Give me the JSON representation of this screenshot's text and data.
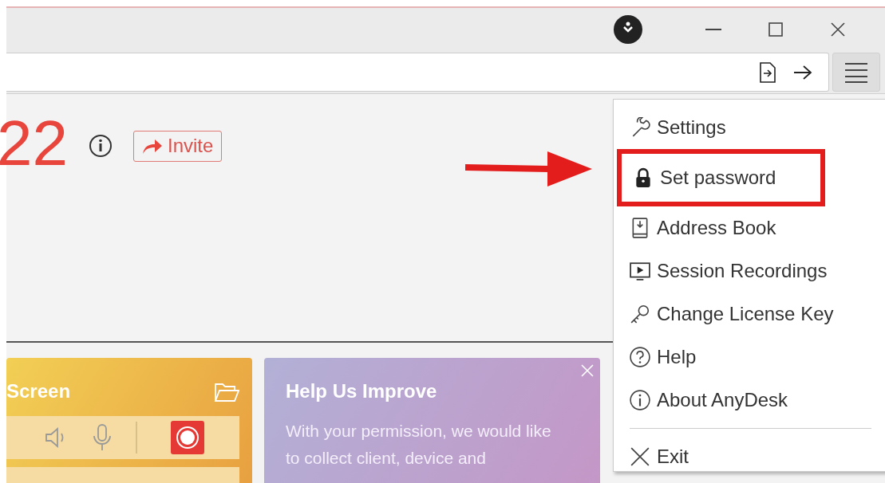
{
  "connection": {
    "id_fragment": "22",
    "invite_label": "Invite"
  },
  "main_menu": {
    "items": [
      {
        "label": "Settings",
        "highlighted": false
      },
      {
        "label": "Set password",
        "highlighted": true
      },
      {
        "label": "Address Book",
        "highlighted": false
      },
      {
        "label": "Session Recordings",
        "highlighted": false
      },
      {
        "label": "Change License Key",
        "highlighted": false
      },
      {
        "label": "Help",
        "highlighted": false
      },
      {
        "label": "About AnyDesk",
        "highlighted": false
      },
      {
        "label": "Exit",
        "highlighted": false,
        "separated": true
      }
    ]
  },
  "cards": [
    {
      "kind": "recording",
      "title": "Screen"
    },
    {
      "kind": "info",
      "title": "Help Us Improve",
      "text": "With your permission, we would like to collect client, device and"
    }
  ]
}
